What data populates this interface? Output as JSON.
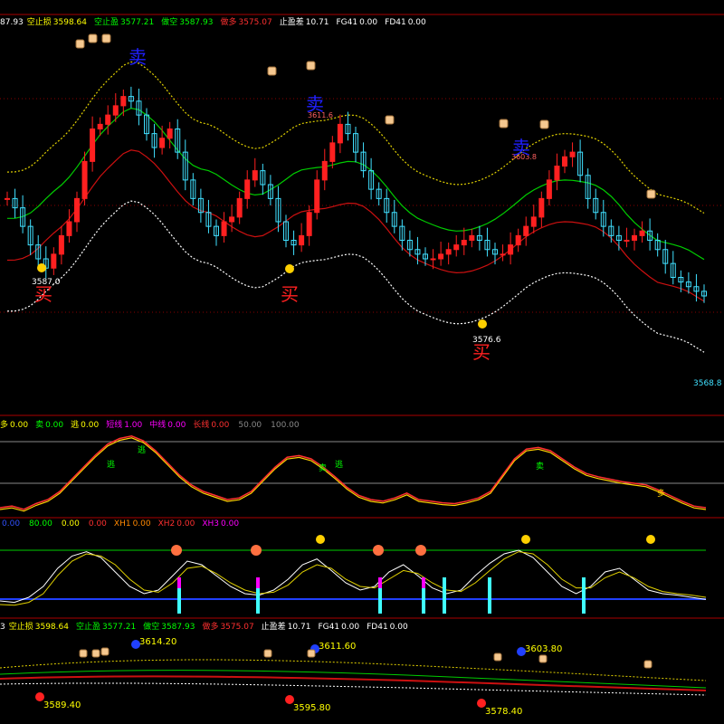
{
  "header1": {
    "lead": "87.93",
    "items": [
      {
        "label": "空止损",
        "value": "3598.64",
        "color": "#ffff00"
      },
      {
        "label": "空止盈",
        "value": "3577.21",
        "color": "#00ff00"
      },
      {
        "label": "做空",
        "value": "3587.93",
        "color": "#00ff00"
      },
      {
        "label": "做多",
        "value": "3575.07",
        "color": "#ff3030"
      },
      {
        "label": "止盈差",
        "value": "10.71",
        "color": "#ffffff"
      },
      {
        "label": "FG41",
        "value": "0.00",
        "color": "#ffffff"
      },
      {
        "label": "FD41",
        "value": "0.00",
        "color": "#ffffff"
      }
    ]
  },
  "header2": {
    "items": [
      {
        "label": "多",
        "value": "0.00",
        "color": "#ffff00"
      },
      {
        "label": "卖",
        "value": "0.00",
        "color": "#00ff00"
      },
      {
        "label": "逃",
        "value": "0.00",
        "color": "#ffff00"
      },
      {
        "label": "短线",
        "value": "1.00",
        "color": "#ff00ff"
      },
      {
        "label": "中线",
        "value": "0.00",
        "color": "#ff00ff"
      },
      {
        "label": "长线",
        "value": "0.00",
        "color": "#ff3030"
      },
      {
        "label": "",
        "value": "50.00",
        "color": "#888888"
      },
      {
        "label": "",
        "value": "100.00",
        "color": "#888888"
      }
    ]
  },
  "header3": {
    "items": [
      {
        "label": "",
        "value": "0.00",
        "color": "#3050ff"
      },
      {
        "label": "",
        "value": "80.00",
        "color": "#00ff00"
      },
      {
        "label": "",
        "value": "0.00",
        "color": "#ffff00"
      },
      {
        "label": "",
        "value": "0.00",
        "color": "#ff3030"
      },
      {
        "label": "XH1",
        "value": "0.00",
        "color": "#ff8800"
      },
      {
        "label": "XH2",
        "value": "0.00",
        "color": "#ff3030"
      },
      {
        "label": "XH3",
        "value": "0.00",
        "color": "#ff00ff"
      }
    ]
  },
  "header4": {
    "lead": "3",
    "items": [
      {
        "label": "空止损",
        "value": "3598.64",
        "color": "#ffff00"
      },
      {
        "label": "空止盈",
        "value": "3577.21",
        "color": "#00ff00"
      },
      {
        "label": "做空",
        "value": "3587.93",
        "color": "#00ff00"
      },
      {
        "label": "做多",
        "value": "3575.07",
        "color": "#ff3030"
      },
      {
        "label": "止盈差",
        "value": "10.71",
        "color": "#ffffff"
      },
      {
        "label": "FG41",
        "value": "0.00",
        "color": "#ffffff"
      },
      {
        "label": "FD41",
        "value": "0.00",
        "color": "#ffffff"
      }
    ]
  },
  "chart_data": [
    {
      "type": "candlestick",
      "panel": "main",
      "close_series_approx": [
        3590,
        3588,
        3584,
        3580,
        3577,
        3575,
        3578,
        3582,
        3585,
        3590,
        3598,
        3605,
        3606,
        3608,
        3610,
        3612,
        3611,
        3608,
        3604,
        3601,
        3603,
        3605,
        3600,
        3594,
        3590,
        3587,
        3584,
        3582,
        3585,
        3586,
        3590,
        3594,
        3596,
        3593,
        3590,
        3585,
        3581,
        3580,
        3582,
        3587,
        3594,
        3598,
        3602,
        3606,
        3604,
        3600,
        3596,
        3592,
        3590,
        3587,
        3584,
        3581,
        3579,
        3578,
        3577,
        3577,
        3578,
        3579,
        3580,
        3581,
        3582,
        3581,
        3579,
        3578,
        3578,
        3580,
        3582,
        3584,
        3586,
        3590,
        3594,
        3597,
        3599,
        3600,
        3595,
        3590,
        3587,
        3584,
        3582,
        3581,
        3581,
        3582,
        3583,
        3581,
        3579,
        3576,
        3573,
        3572,
        3571,
        3570,
        3569
      ],
      "price_labels": [
        {
          "text": "3587.0",
          "color": "#ffffff"
        },
        {
          "text": "3576.6",
          "color": "#ffffff"
        },
        {
          "text": "3568.8",
          "color": "#40e0ff"
        }
      ],
      "top_markers": [
        "3611.6",
        "3603.8"
      ],
      "buy_signal": "买",
      "sell_signal": "卖",
      "series": [
        {
          "name": "upper",
          "color": "#e0d000"
        },
        {
          "name": "mid",
          "color": "#00cc00"
        },
        {
          "name": "lower",
          "color": "#cc1010"
        },
        {
          "name": "bottom",
          "color": "#ffffff"
        }
      ]
    },
    {
      "type": "line",
      "panel": "oscillator1",
      "levels": [
        0,
        50,
        100
      ],
      "labels": [
        "逃",
        "逃",
        "卖",
        "逃",
        "卖",
        "多"
      ],
      "curve": [
        10,
        12,
        8,
        15,
        20,
        30,
        45,
        60,
        75,
        88,
        95,
        98,
        92,
        80,
        65,
        50,
        38,
        30,
        25,
        20,
        22,
        30,
        45,
        60,
        72,
        74,
        70,
        60,
        48,
        35,
        25,
        20,
        18,
        22,
        28,
        20,
        18,
        16,
        15,
        18,
        22,
        30,
        50,
        70,
        82,
        84,
        80,
        70,
        60,
        52,
        48,
        45,
        42,
        40,
        38,
        32,
        25,
        18,
        12,
        10
      ]
    },
    {
      "type": "line",
      "panel": "oscillator2",
      "levels": [
        0,
        80
      ],
      "white_curve": [
        20,
        18,
        25,
        40,
        65,
        82,
        88,
        80,
        60,
        40,
        30,
        35,
        55,
        75,
        70,
        55,
        40,
        30,
        28,
        35,
        50,
        70,
        78,
        62,
        45,
        35,
        40,
        60,
        70,
        55,
        38,
        30,
        35,
        55,
        72,
        85,
        90,
        80,
        60,
        40,
        30,
        40,
        60,
        65,
        50,
        35,
        30,
        28,
        25,
        22
      ],
      "yellow_curve": [
        15,
        14,
        18,
        30,
        55,
        75,
        85,
        82,
        70,
        50,
        35,
        32,
        45,
        65,
        68,
        58,
        45,
        35,
        30,
        32,
        42,
        60,
        70,
        65,
        50,
        40,
        38,
        50,
        62,
        58,
        45,
        35,
        33,
        45,
        62,
        78,
        88,
        85,
        70,
        50,
        38,
        38,
        52,
        60,
        52,
        40,
        33,
        30,
        28,
        25
      ]
    },
    {
      "type": "line",
      "panel": "overview",
      "markers": [
        {
          "text": "3614.20",
          "kind": "high"
        },
        {
          "text": "3611.60",
          "kind": "high"
        },
        {
          "text": "3603.80",
          "kind": "high"
        },
        {
          "text": "3589.40",
          "kind": "low"
        },
        {
          "text": "3595.80",
          "kind": "low"
        },
        {
          "text": "3578.40",
          "kind": "low"
        }
      ]
    }
  ]
}
